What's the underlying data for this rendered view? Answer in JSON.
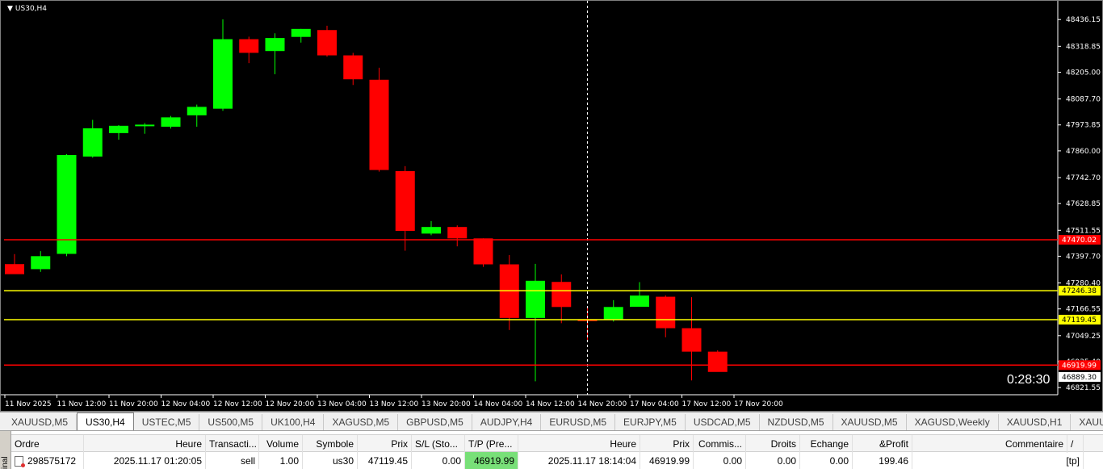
{
  "chart": {
    "symbol_label": "US30,H4",
    "countdown": "0:28:30",
    "colors": {
      "background": "#000000",
      "bull": "#00ff00",
      "bear": "#ff0000",
      "axis_text": "#ffffff",
      "red_level": "#ff0000",
      "yellow_level": "#ffff00"
    }
  },
  "chart_data": {
    "type": "candlestick",
    "timeframe": "H4",
    "y_ticks": [
      "48436.15",
      "48318.85",
      "48205.00",
      "48087.70",
      "47973.85",
      "47860.00",
      "47742.70",
      "47628.85",
      "47511.55",
      "47397.70",
      "47280.40",
      "47166.55",
      "47049.25",
      "46935.40",
      "46821.55"
    ],
    "x_ticks": [
      "11 Nov 2025",
      "11 Nov 12:00",
      "11 Nov 20:00",
      "12 Nov 04:00",
      "12 Nov 12:00",
      "12 Nov 20:00",
      "13 Nov 04:00",
      "13 Nov 12:00",
      "13 Nov 20:00",
      "14 Nov 04:00",
      "14 Nov 12:00",
      "14 Nov 20:00",
      "17 Nov 04:00",
      "17 Nov 12:00",
      "17 Nov 20:00"
    ],
    "ylim": [
      46790,
      48490
    ],
    "candles": [
      {
        "o": 47363,
        "h": 47407,
        "l": 47341,
        "c": 47319
      },
      {
        "o": 47341,
        "h": 47420,
        "l": 47329,
        "c": 47398
      },
      {
        "o": 47408,
        "h": 47846,
        "l": 47398,
        "c": 47842
      },
      {
        "o": 47835,
        "h": 47996,
        "l": 47830,
        "c": 47959
      },
      {
        "o": 47938,
        "h": 47973,
        "l": 47909,
        "c": 47970
      },
      {
        "o": 47968,
        "h": 47982,
        "l": 47935,
        "c": 47975
      },
      {
        "o": 47966,
        "h": 48013,
        "l": 47958,
        "c": 48007
      },
      {
        "o": 48016,
        "h": 48063,
        "l": 47966,
        "c": 48053
      },
      {
        "o": 48045,
        "h": 48437,
        "l": 48036,
        "c": 48350
      },
      {
        "o": 48350,
        "h": 48361,
        "l": 48245,
        "c": 48290
      },
      {
        "o": 48298,
        "h": 48376,
        "l": 48196,
        "c": 48355
      },
      {
        "o": 48360,
        "h": 48395,
        "l": 48335,
        "c": 48395
      },
      {
        "o": 48390,
        "h": 48409,
        "l": 48273,
        "c": 48279
      },
      {
        "o": 48279,
        "h": 48290,
        "l": 48149,
        "c": 48174
      },
      {
        "o": 48172,
        "h": 48225,
        "l": 47769,
        "c": 47776
      },
      {
        "o": 47771,
        "h": 47793,
        "l": 47422,
        "c": 47509
      },
      {
        "o": 47497,
        "h": 47552,
        "l": 47490,
        "c": 47526
      },
      {
        "o": 47526,
        "h": 47533,
        "l": 47441,
        "c": 47476
      },
      {
        "o": 47476,
        "h": 47476,
        "l": 47351,
        "c": 47362
      },
      {
        "o": 47362,
        "h": 47403,
        "l": 47074,
        "c": 47127
      },
      {
        "o": 47127,
        "h": 47364,
        "l": 46849,
        "c": 47290
      },
      {
        "o": 47285,
        "h": 47318,
        "l": 47104,
        "c": 47175
      },
      {
        "o": 47119,
        "h": 47170,
        "l": 47029,
        "c": 47113
      },
      {
        "o": 47118,
        "h": 47205,
        "l": 47111,
        "c": 47175
      },
      {
        "o": 47176,
        "h": 47284,
        "l": 47176,
        "c": 47225
      },
      {
        "o": 47220,
        "h": 47226,
        "l": 47042,
        "c": 47082
      },
      {
        "o": 47082,
        "h": 47218,
        "l": 46853,
        "c": 46979
      },
      {
        "o": 46979,
        "h": 46985,
        "l": 46894,
        "c": 46890
      }
    ],
    "levels": [
      {
        "label": "47470.02",
        "value": 47470.02,
        "color": "#ff0000"
      },
      {
        "label": "47246.38",
        "value": 47246.38,
        "color": "#ffff00"
      },
      {
        "label": "47119.45",
        "value": 47119.45,
        "color": "#ffff00"
      },
      {
        "label": "46919.99",
        "value": 46919.99,
        "color": "#ff0000"
      }
    ],
    "bid_label": "46889.30",
    "bid_value": 46889.3,
    "crosshair_candle_index": 22
  },
  "tabs": {
    "active_index": 1,
    "items": [
      "XAUUSD,M5",
      "US30,H4",
      "USTEC,M5",
      "US500,M5",
      "UK100,H4",
      "XAGUSD,M5",
      "GBPUSD,M5",
      "AUDJPY,H4",
      "EURUSD,M5",
      "EURJPY,M5",
      "USDCAD,M5",
      "NZDUSD,M5",
      "XAUUSD,M5",
      "XAGUSD,Weekly",
      "XAUUSD,H1",
      "XAUUSD,H"
    ]
  },
  "terminal": {
    "side_label": "inal",
    "headers": {
      "order": "Ordre",
      "open_time": "Heure",
      "type": "Transacti...",
      "volume": "Volume",
      "symbol": "Symbole",
      "open_price": "Prix",
      "sl": "S/L (Sto...",
      "tp": "T/P (Pre...",
      "close_time": "Heure",
      "close_price": "Prix",
      "commission": "Commis...",
      "swap": "Droits",
      "exchange": "Echange",
      "profit": "&Profit",
      "comment": "Commentaire",
      "sort_mark": "/"
    },
    "row": {
      "order": "298575172",
      "open_time": "2025.11.17 01:20:05",
      "type": "sell",
      "volume": "1.00",
      "symbol": "us30",
      "open_price": "47119.45",
      "sl": "0.00",
      "tp": "46919.99",
      "close_time": "2025.11.17 18:14:04",
      "close_price": "46919.99",
      "commission": "0.00",
      "swap": "0.00",
      "exchange": "0.00",
      "profit": "199.46",
      "comment": "[tp]"
    }
  }
}
